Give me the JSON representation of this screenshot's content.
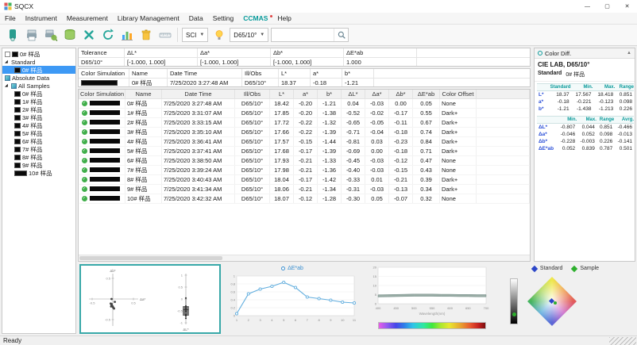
{
  "window": {
    "title": "SQCX",
    "status": "Ready"
  },
  "menu": {
    "items": [
      {
        "label": "File"
      },
      {
        "label": "Instrument"
      },
      {
        "label": "Measurement"
      },
      {
        "label": "Library Management"
      },
      {
        "label": "Data"
      },
      {
        "label": "Setting"
      },
      {
        "label": "CCMAS",
        "accent": true
      },
      {
        "label": "Help"
      }
    ]
  },
  "toolbar": {
    "sci": "SCI",
    "illobs": "D65/10°",
    "search_value": "",
    "icons": [
      "measure-icon",
      "print-icon",
      "print-preview-icon",
      "database-icon",
      "delete-icon",
      "refresh-icon",
      "chart-icon",
      "clear-icon",
      "ruler-icon",
      "light-source-icon",
      "search-icon"
    ]
  },
  "sidebar": {
    "root_item": "0# 样品",
    "groups": [
      {
        "label": "Standard",
        "arrow": true,
        "cube": false,
        "children": [
          "0# 样品"
        ],
        "selected": 0
      },
      {
        "label": "Absolute Data",
        "arrow": false,
        "cube": true,
        "children": []
      },
      {
        "label": "All Samples",
        "arrow": true,
        "cube": true,
        "children": [
          "0# 样品",
          "1# 样品",
          "2# 样品",
          "3# 样品",
          "4# 样品",
          "5# 样品",
          "6# 样品",
          "7# 样品",
          "8# 样品",
          "9# 样品",
          "10# 样品"
        ],
        "current": 10
      }
    ]
  },
  "tolerance": {
    "title": "Tolerance",
    "headers": [
      "ΔL*",
      "Δa*",
      "Δb*",
      "ΔE*ab"
    ],
    "illobs": "D65/10°",
    "values": [
      "[-1.000, 1.000]",
      "[-1.000, 1.000]",
      "[-1.000, 1.000]",
      "1.000"
    ]
  },
  "standard_bar": {
    "headers": [
      "Color Simulation",
      "Name",
      "Date Time",
      "Ill/Obs",
      "L*",
      "a*",
      "b*"
    ],
    "row": {
      "name": "0# 样品",
      "datetime": "7/25/2020 3:27:48 AM",
      "illobs": "D65/10°",
      "L": "18.37",
      "a": "-0.18",
      "b": "-1.21"
    }
  },
  "table": {
    "headers": [
      "Color Simulation",
      "Name",
      "Date Time",
      "Ill/Obs",
      "L*",
      "a*",
      "b*",
      "ΔL*",
      "Δa*",
      "Δb*",
      "ΔE*ab",
      "Color Offset"
    ],
    "rows": [
      {
        "name": "0# 样品",
        "datetime": "7/25/2020 3:27:48 AM",
        "illobs": "D65/10°",
        "L": "18.42",
        "a": "-0.20",
        "b": "-1.21",
        "dL": "0.04",
        "da": "-0.03",
        "db": "0.00",
        "dE": "0.05",
        "offset": "None"
      },
      {
        "name": "1# 样品",
        "datetime": "7/25/2020 3:31:07 AM",
        "illobs": "D65/10°",
        "L": "17.85",
        "a": "-0.20",
        "b": "-1.38",
        "dL": "-0.52",
        "da": "-0.02",
        "db": "-0.17",
        "dE": "0.55",
        "offset": "Dark+"
      },
      {
        "name": "2# 样品",
        "datetime": "7/25/2020 3:33:15 AM",
        "illobs": "D65/10°",
        "L": "17.72",
        "a": "-0.22",
        "b": "-1.32",
        "dL": "-0.65",
        "da": "-0.05",
        "db": "-0.11",
        "dE": "0.67",
        "offset": "Dark+"
      },
      {
        "name": "3# 样品",
        "datetime": "7/25/2020 3:35:10 AM",
        "illobs": "D65/10°",
        "L": "17.66",
        "a": "-0.22",
        "b": "-1.39",
        "dL": "-0.71",
        "da": "-0.04",
        "db": "-0.18",
        "dE": "0.74",
        "offset": "Dark+"
      },
      {
        "name": "4# 样品",
        "datetime": "7/25/2020 3:36:41 AM",
        "illobs": "D65/10°",
        "L": "17.57",
        "a": "-0.15",
        "b": "-1.44",
        "dL": "-0.81",
        "da": "0.03",
        "db": "-0.23",
        "dE": "0.84",
        "offset": "Dark+"
      },
      {
        "name": "5# 样品",
        "datetime": "7/25/2020 3:37:41 AM",
        "illobs": "D65/10°",
        "L": "17.68",
        "a": "-0.17",
        "b": "-1.39",
        "dL": "-0.69",
        "da": "0.00",
        "db": "-0.18",
        "dE": "0.71",
        "offset": "Dark+"
      },
      {
        "name": "6# 样品",
        "datetime": "7/25/2020 3:38:50 AM",
        "illobs": "D65/10°",
        "L": "17.93",
        "a": "-0.21",
        "b": "-1.33",
        "dL": "-0.45",
        "da": "-0.03",
        "db": "-0.12",
        "dE": "0.47",
        "offset": "None"
      },
      {
        "name": "7# 样品",
        "datetime": "7/25/2020 3:39:24 AM",
        "illobs": "D65/10°",
        "L": "17.98",
        "a": "-0.21",
        "b": "-1.36",
        "dL": "-0.40",
        "da": "-0.03",
        "db": "-0.15",
        "dE": "0.43",
        "offset": "None"
      },
      {
        "name": "8# 样品",
        "datetime": "7/25/2020 3:40:43 AM",
        "illobs": "D65/10°",
        "L": "18.04",
        "a": "-0.17",
        "b": "-1.42",
        "dL": "-0.33",
        "da": "0.01",
        "db": "-0.21",
        "dE": "0.39",
        "offset": "Dark+"
      },
      {
        "name": "9# 样品",
        "datetime": "7/25/2020 3:41:34 AM",
        "illobs": "D65/10°",
        "L": "18.06",
        "a": "-0.21",
        "b": "-1.34",
        "dL": "-0.31",
        "da": "-0.03",
        "db": "-0.13",
        "dE": "0.34",
        "offset": "Dark+"
      },
      {
        "name": "10# 样品",
        "datetime": "7/25/2020 3:42:32 AM",
        "illobs": "D65/10°",
        "L": "18.07",
        "a": "-0.12",
        "b": "-1.28",
        "dL": "-0.30",
        "da": "0.05",
        "db": "-0.07",
        "dE": "0.32",
        "offset": "None"
      }
    ]
  },
  "color_diff": {
    "panel_title": "Color Diff.",
    "subtitle": "CIE LAB, D65/10°",
    "standard_label": "Standard",
    "standard_name": "0# 样品",
    "abs_table": {
      "headers": [
        "",
        "Standard",
        "Min.",
        "Max.",
        "Range"
      ],
      "rows": [
        {
          "label": "L*",
          "values": [
            "18.37",
            "17.567",
            "18.418",
            "0.851"
          ]
        },
        {
          "label": "a*",
          "values": [
            "-0.18",
            "-0.221",
            "-0.123",
            "0.098"
          ]
        },
        {
          "label": "b*",
          "values": [
            "-1.21",
            "-1.438",
            "-1.213",
            "0.226"
          ]
        }
      ]
    },
    "diff_table": {
      "headers": [
        "",
        "Min.",
        "Max.",
        "Range",
        "Avrg."
      ],
      "rows": [
        {
          "label": "ΔL*",
          "values": [
            "-0.807",
            "0.044",
            "0.851",
            "-0.466"
          ]
        },
        {
          "label": "Δa*",
          "values": [
            "-0.046",
            "0.052",
            "0.098",
            "-0.013"
          ]
        },
        {
          "label": "Δb*",
          "values": [
            "-0.228",
            "-0.003",
            "0.226",
            "-0.141"
          ]
        },
        {
          "label": "ΔE*ab",
          "values": [
            "0.052",
            "0.839",
            "0.787",
            "0.501"
          ]
        }
      ]
    }
  },
  "charts": {
    "scatter": {
      "type": "scatter",
      "xlabel": "Δa*",
      "ylabel": "Δb*",
      "strip_label": "ΔL*",
      "xlim": [
        -0.5,
        0.5
      ],
      "ylim": [
        -0.5,
        0.5
      ],
      "strip_lim": [
        -1,
        1
      ],
      "points_da": [
        -0.03,
        -0.02,
        -0.05,
        -0.04,
        0.03,
        0.0,
        -0.03,
        -0.03,
        0.01,
        -0.03,
        0.05
      ],
      "points_db": [
        0.0,
        -0.17,
        -0.11,
        -0.18,
        -0.23,
        -0.18,
        -0.12,
        -0.15,
        -0.21,
        -0.13,
        -0.07
      ],
      "strip_values_dL": [
        0.04,
        -0.52,
        -0.65,
        -0.71,
        -0.81,
        -0.69,
        -0.45,
        -0.4,
        -0.33,
        -0.31,
        -0.3
      ]
    },
    "trend": {
      "type": "line",
      "title": "ΔE*ab",
      "x": [
        1,
        2,
        3,
        4,
        5,
        6,
        7,
        8,
        9,
        10,
        11
      ],
      "values": [
        0.05,
        0.55,
        0.67,
        0.74,
        0.84,
        0.71,
        0.47,
        0.43,
        0.39,
        0.34,
        0.32
      ],
      "ylim": [
        0,
        1
      ],
      "y_ticks": [
        0,
        0.2,
        0.4,
        0.6,
        0.8,
        1
      ]
    },
    "spectral": {
      "type": "area",
      "xlabel": "Wavelength(nm)",
      "x_ticks": [
        400,
        450,
        500,
        550,
        600,
        650,
        700
      ],
      "ylim": [
        0,
        20
      ],
      "y_ticks": [
        0,
        5,
        10,
        15,
        20
      ],
      "x_start": 400,
      "x_step": 25,
      "band_high": [
        4.9,
        5.0,
        5.1,
        5.2,
        5.3,
        5.3,
        5.3,
        5.2,
        5.2,
        5.1,
        5.1,
        5.0,
        5.0
      ],
      "band_low": [
        3.7,
        3.8,
        3.9,
        4.0,
        4.1,
        4.1,
        4.1,
        4.0,
        4.0,
        3.9,
        3.9,
        3.8,
        3.8
      ]
    },
    "chromaticity": {
      "type": "scatter",
      "legend": [
        {
          "label": "Standard",
          "color": "#2c46c8"
        },
        {
          "label": "Sample",
          "color": "#2daf2d"
        }
      ]
    }
  },
  "colors": {
    "accent": "#069a9a",
    "selection": "#3d99f5",
    "check_green": "#3fae49",
    "trend_line": "#62aede",
    "standard_marker": "#2c46c8",
    "sample_marker": "#2daf2d",
    "swatch": "#0a0a0a"
  }
}
